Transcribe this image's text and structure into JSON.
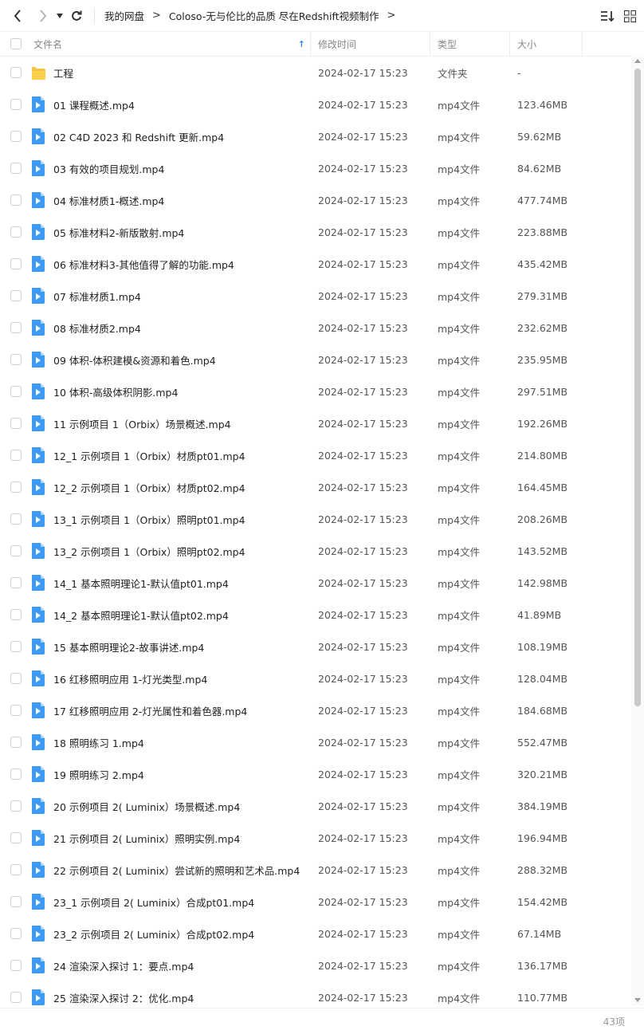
{
  "toolbar": {
    "back_icon": "chevron-left-icon",
    "forward_icon": "chevron-right-icon",
    "dropdown_icon": "caret-down-icon",
    "refresh_icon": "refresh-icon",
    "sort_icon": "sort-list-icon",
    "view_icon": "grid-view-icon"
  },
  "breadcrumb": {
    "root": "我的网盘",
    "current": "Coloso-无与伦比的品质 尽在Redshift视频制作",
    "separator": ">"
  },
  "columns": {
    "name": "文件名",
    "modified": "修改时间",
    "type": "类型",
    "size": "大小",
    "sort_indicator": "↑"
  },
  "colors": {
    "accent": "#3b8cf3",
    "folder": "#f7c441",
    "video": "#3e9bf4"
  },
  "files": [
    {
      "name": "工程",
      "modified": "2024-02-17 15:23",
      "type": "文件夹",
      "size": "-",
      "icon": "folder-icon"
    },
    {
      "name": "01 课程概述.mp4",
      "modified": "2024-02-17 15:23",
      "type": "mp4文件",
      "size": "123.46MB",
      "icon": "video-file-icon"
    },
    {
      "name": "02 C4D 2023 和 Redshift 更新.mp4",
      "modified": "2024-02-17 15:23",
      "type": "mp4文件",
      "size": "59.62MB",
      "icon": "video-file-icon"
    },
    {
      "name": "03 有效的项目规划.mp4",
      "modified": "2024-02-17 15:23",
      "type": "mp4文件",
      "size": "84.62MB",
      "icon": "video-file-icon"
    },
    {
      "name": "04 标准材质1-概述.mp4",
      "modified": "2024-02-17 15:23",
      "type": "mp4文件",
      "size": "477.74MB",
      "icon": "video-file-icon"
    },
    {
      "name": "05 标准材料2-新版散射.mp4",
      "modified": "2024-02-17 15:23",
      "type": "mp4文件",
      "size": "223.88MB",
      "icon": "video-file-icon"
    },
    {
      "name": "06 标准材料3-其他值得了解的功能.mp4",
      "modified": "2024-02-17 15:23",
      "type": "mp4文件",
      "size": "435.42MB",
      "icon": "video-file-icon"
    },
    {
      "name": "07 标准材质1.mp4",
      "modified": "2024-02-17 15:23",
      "type": "mp4文件",
      "size": "279.31MB",
      "icon": "video-file-icon"
    },
    {
      "name": "08 标准材质2.mp4",
      "modified": "2024-02-17 15:23",
      "type": "mp4文件",
      "size": "232.62MB",
      "icon": "video-file-icon"
    },
    {
      "name": "09 体积-体积建模&资源和着色.mp4",
      "modified": "2024-02-17 15:23",
      "type": "mp4文件",
      "size": "235.95MB",
      "icon": "video-file-icon"
    },
    {
      "name": "10 体积-高级体积阴影.mp4",
      "modified": "2024-02-17 15:23",
      "type": "mp4文件",
      "size": "297.51MB",
      "icon": "video-file-icon"
    },
    {
      "name": "11 示例项目 1（Orbix）场景概述.mp4",
      "modified": "2024-02-17 15:23",
      "type": "mp4文件",
      "size": "192.26MB",
      "icon": "video-file-icon"
    },
    {
      "name": "12_1 示例项目 1（Orbix）材质pt01.mp4",
      "modified": "2024-02-17 15:23",
      "type": "mp4文件",
      "size": "214.80MB",
      "icon": "video-file-icon"
    },
    {
      "name": "12_2 示例项目 1（Orbix）材质pt02.mp4",
      "modified": "2024-02-17 15:23",
      "type": "mp4文件",
      "size": "164.45MB",
      "icon": "video-file-icon"
    },
    {
      "name": "13_1 示例项目 1（Orbix）照明pt01.mp4",
      "modified": "2024-02-17 15:23",
      "type": "mp4文件",
      "size": "208.26MB",
      "icon": "video-file-icon"
    },
    {
      "name": "13_2 示例项目 1（Orbix）照明pt02.mp4",
      "modified": "2024-02-17 15:23",
      "type": "mp4文件",
      "size": "143.52MB",
      "icon": "video-file-icon"
    },
    {
      "name": "14_1 基本照明理论1-默认值pt01.mp4",
      "modified": "2024-02-17 15:23",
      "type": "mp4文件",
      "size": "142.98MB",
      "icon": "video-file-icon"
    },
    {
      "name": "14_2 基本照明理论1-默认值pt02.mp4",
      "modified": "2024-02-17 15:23",
      "type": "mp4文件",
      "size": "41.89MB",
      "icon": "video-file-icon"
    },
    {
      "name": "15 基本照明理论2-故事讲述.mp4",
      "modified": "2024-02-17 15:23",
      "type": "mp4文件",
      "size": "108.19MB",
      "icon": "video-file-icon"
    },
    {
      "name": "16 红移照明应用 1-灯光类型.mp4",
      "modified": "2024-02-17 15:23",
      "type": "mp4文件",
      "size": "128.04MB",
      "icon": "video-file-icon"
    },
    {
      "name": "17 红移照明应用 2-灯光属性和着色器.mp4",
      "modified": "2024-02-17 15:23",
      "type": "mp4文件",
      "size": "184.68MB",
      "icon": "video-file-icon"
    },
    {
      "name": "18 照明练习 1.mp4",
      "modified": "2024-02-17 15:23",
      "type": "mp4文件",
      "size": "552.47MB",
      "icon": "video-file-icon"
    },
    {
      "name": "19 照明练习 2.mp4",
      "modified": "2024-02-17 15:23",
      "type": "mp4文件",
      "size": "320.21MB",
      "icon": "video-file-icon"
    },
    {
      "name": "20 示例项目 2( Luminix）场景概述.mp4",
      "modified": "2024-02-17 15:23",
      "type": "mp4文件",
      "size": "384.19MB",
      "icon": "video-file-icon"
    },
    {
      "name": "21 示例项目 2( Luminix）照明实例.mp4",
      "modified": "2024-02-17 15:23",
      "type": "mp4文件",
      "size": "196.94MB",
      "icon": "video-file-icon"
    },
    {
      "name": "22 示例项目 2( Luminix）尝试新的照明和艺术品.mp4",
      "modified": "2024-02-17 15:23",
      "type": "mp4文件",
      "size": "288.32MB",
      "icon": "video-file-icon"
    },
    {
      "name": "23_1 示例项目 2( Luminix）合成pt01.mp4",
      "modified": "2024-02-17 15:23",
      "type": "mp4文件",
      "size": "154.42MB",
      "icon": "video-file-icon"
    },
    {
      "name": "23_2 示例项目 2( Luminix）合成pt02.mp4",
      "modified": "2024-02-17 15:23",
      "type": "mp4文件",
      "size": "67.14MB",
      "icon": "video-file-icon"
    },
    {
      "name": "24 渲染深入探讨 1：要点.mp4",
      "modified": "2024-02-17 15:23",
      "type": "mp4文件",
      "size": "136.17MB",
      "icon": "video-file-icon"
    },
    {
      "name": "25 渲染深入探讨 2：优化.mp4",
      "modified": "2024-02-17 15:23",
      "type": "mp4文件",
      "size": "110.77MB",
      "icon": "video-file-icon"
    }
  ],
  "footer": {
    "item_count": "43项"
  }
}
